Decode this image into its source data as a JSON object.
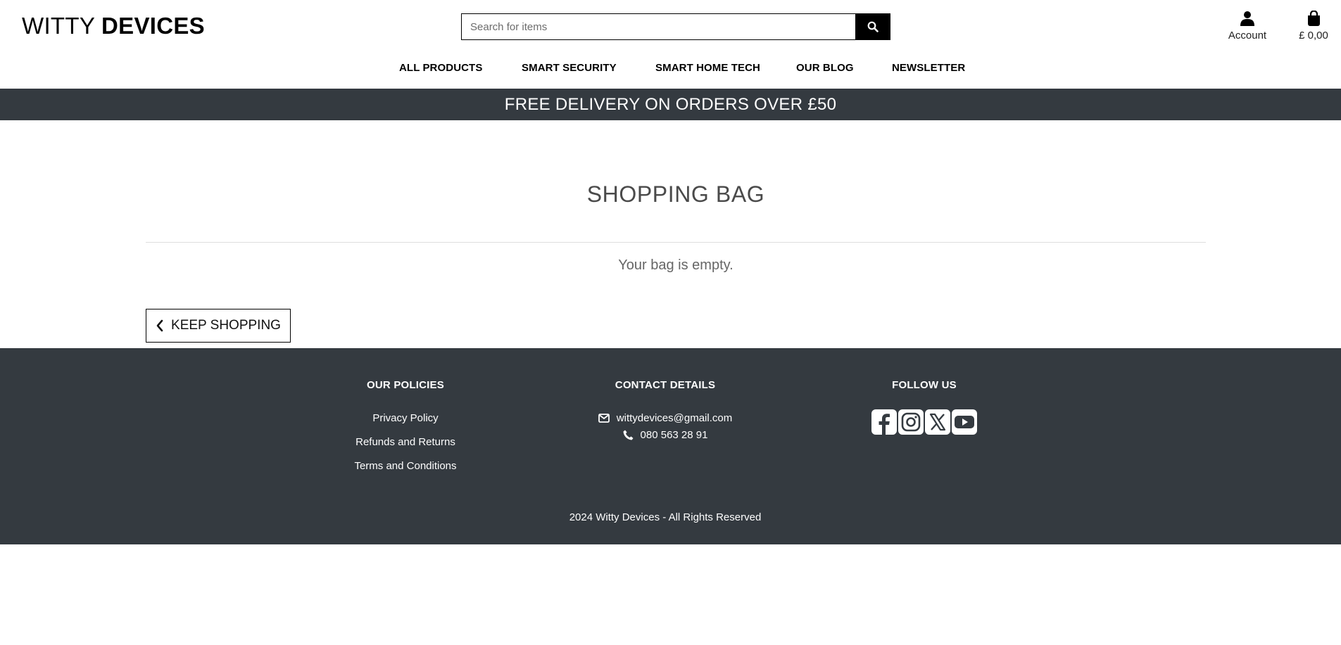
{
  "brand": {
    "light": "WITTY",
    "bold": "DEVICES"
  },
  "search": {
    "placeholder": "Search for items"
  },
  "account": {
    "label": "Account"
  },
  "bag": {
    "total": "£ 0,00"
  },
  "nav": [
    {
      "label": "ALL PRODUCTS"
    },
    {
      "label": "SMART SECURITY"
    },
    {
      "label": "SMART HOME TECH"
    },
    {
      "label": "OUR BLOG"
    },
    {
      "label": "NEWSLETTER"
    }
  ],
  "banner": {
    "text": "FREE DELIVERY ON ORDERS OVER £50"
  },
  "main": {
    "title": "SHOPPING BAG",
    "empty_message": "Your bag is empty.",
    "keep_shopping": "KEEP SHOPPING"
  },
  "footer": {
    "policies": {
      "heading": "OUR POLICIES",
      "links": [
        "Privacy Policy",
        "Refunds and Returns",
        "Terms and Conditions"
      ]
    },
    "contact": {
      "heading": "CONTACT DETAILS",
      "email": "wittydevices@gmail.com",
      "phone": "080 563 28 91"
    },
    "follow": {
      "heading": "FOLLOW US",
      "icons": [
        "facebook-icon",
        "instagram-icon",
        "x-icon",
        "youtube-icon"
      ]
    },
    "copyright": "2024 Witty Devices - All Rights Reserved"
  },
  "colors": {
    "dark": "#343a40",
    "black": "#000000",
    "white": "#ffffff"
  }
}
